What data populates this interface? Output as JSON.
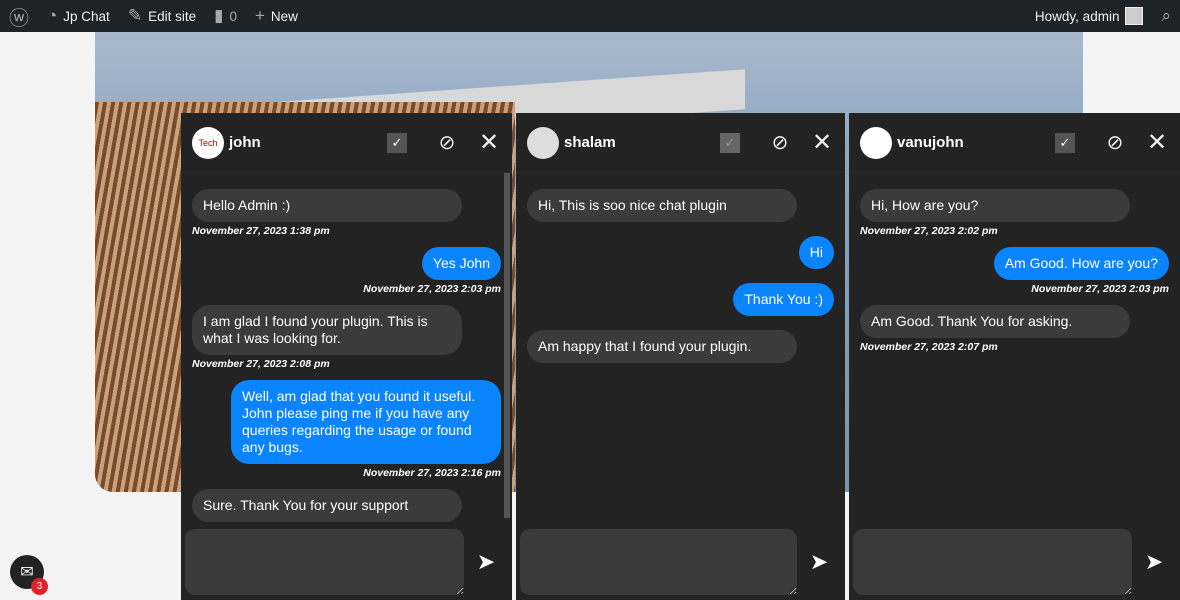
{
  "adminbar": {
    "site": "Jp Chat",
    "edit": "Edit site",
    "comments": "0",
    "new": "New",
    "howdy": "Howdy, admin"
  },
  "panels": [
    {
      "name": "john",
      "avatar_text": "Tech",
      "messages": [
        {
          "dir": "in",
          "text": "Hello Admin :)",
          "time": "November 27, 2023 1:38 pm"
        },
        {
          "dir": "out",
          "text": "Yes John",
          "time": "November 27, 2023 2:03 pm"
        },
        {
          "dir": "in",
          "text": "I am glad I found your plugin. This is what I was looking for.",
          "time": "November 27, 2023 2:08 pm"
        },
        {
          "dir": "out",
          "text": "Well, am glad that you found it useful. John please ping me if you have any queries regarding the usage or found any bugs.",
          "time": "November 27, 2023 2:16 pm"
        },
        {
          "dir": "in",
          "text": "Sure. Thank You for your support",
          "time": ""
        }
      ]
    },
    {
      "name": "shalam",
      "avatar_text": "",
      "messages": [
        {
          "dir": "in",
          "text": "Hi, This is soo nice chat plugin",
          "time": ""
        },
        {
          "dir": "out",
          "text": "Hi",
          "time": ""
        },
        {
          "dir": "out",
          "text": "Thank You :)",
          "time": ""
        },
        {
          "dir": "in",
          "text": "Am happy that I found your plugin.",
          "time": ""
        }
      ]
    },
    {
      "name": "vanujohn",
      "avatar_text": "",
      "messages": [
        {
          "dir": "in",
          "text": "Hi, How are you?",
          "time": "November 27, 2023 2:02 pm"
        },
        {
          "dir": "out",
          "text": "Am Good. How are you?",
          "time": "November 27, 2023 2:03 pm"
        },
        {
          "dir": "in",
          "text": "Am Good. Thank You for asking.",
          "time": "November 27, 2023 2:07 pm"
        }
      ]
    }
  ],
  "fab": {
    "badge": "3"
  }
}
